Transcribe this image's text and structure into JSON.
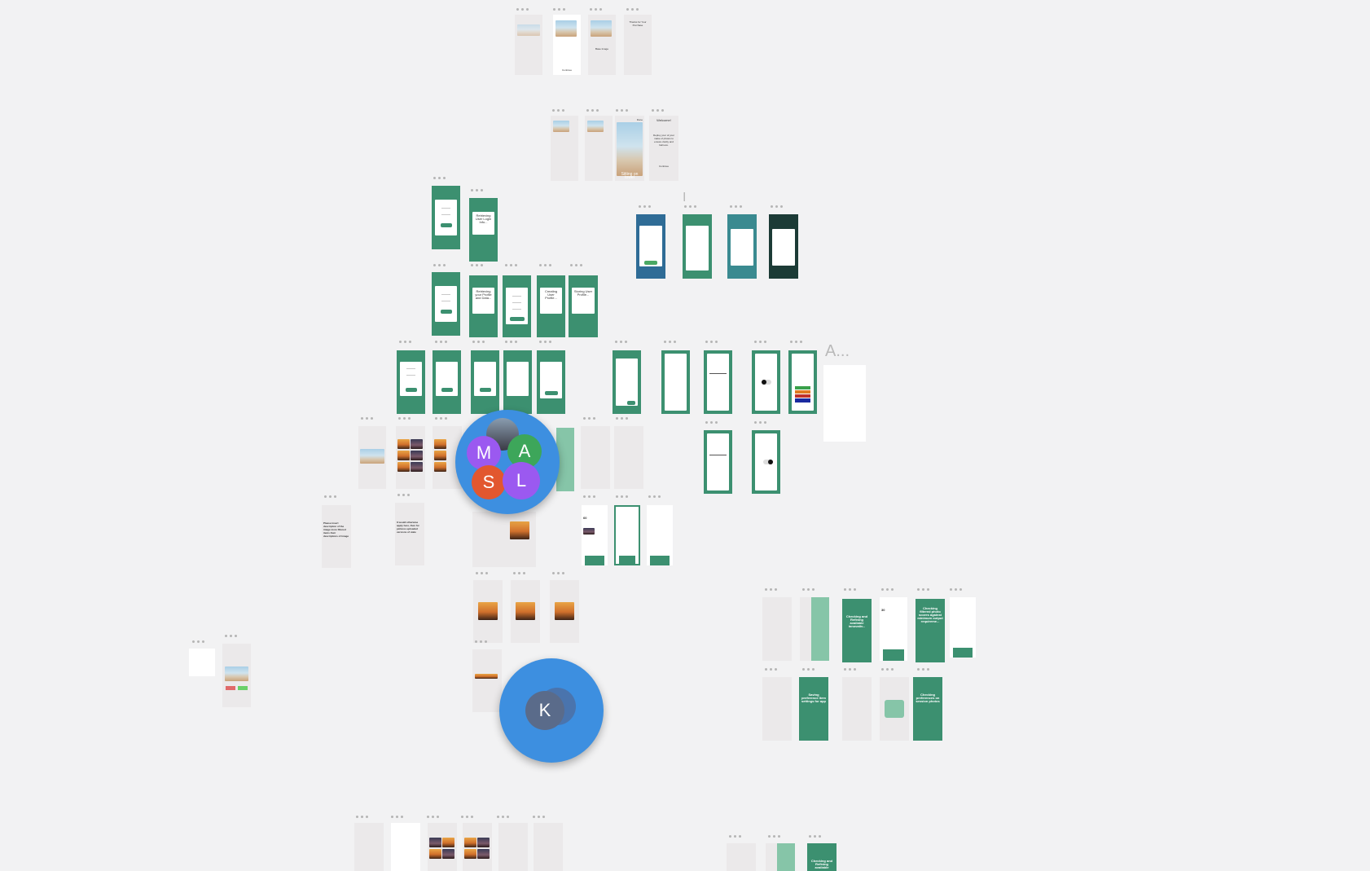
{
  "board": {
    "frame_labels": {
      "thanks": "Thanks for Your Purchase",
      "continue": "Continue",
      "base_image": "Base Image",
      "sitting_on_towel": "Sitting on towel",
      "done": "Done",
      "welcome": "Welcome!",
      "welcome_body": "Deploy your of your make of photos to ensure clarity and fairness.",
      "retrieving_user_login": "Retrieving User Login Info...",
      "retrieving_profile": "Retrieving your Profile and Data...",
      "creating_profile": "Creating User Profile...",
      "storing_profile": "Storing User Profile...",
      "checking_refining": "Checking and Refining available innovativ...",
      "checking_filtered": "Checking filtered photo scores against minimum output requireme...",
      "saving_preferences": "Saving preference item settings for app",
      "checking_preferences": "Checking preferences on session photos",
      "checking_refining_bottom": "Checking and Refining available",
      "balance_60": "60",
      "balance_30": "30",
      "free_text_1": "Please insert description of the image more filtered items their descriptions of image",
      "free_text_2": "It would otherwise apply here, then for pictures uploaded versions of state"
    },
    "board_title_a": "A...",
    "board_title_i": "I"
  },
  "collaborators": {
    "group": [
      "M",
      "A",
      "S",
      "L"
    ],
    "single": "K",
    "colors": {
      "M": "#9b59f0",
      "A": "#3da65a",
      "S": "#e2572f",
      "L": "#9b59f0",
      "K": "#5a6b8a",
      "bubble": "#3d8fe0"
    }
  },
  "colors": {
    "canvas": "#f2f2f3",
    "green": "#3c9070",
    "mint": "#86c5a8",
    "blue": "#2f6c96",
    "teal": "#3a8a90",
    "dark": "#1c3b36",
    "frame": "#ebe9ea"
  }
}
